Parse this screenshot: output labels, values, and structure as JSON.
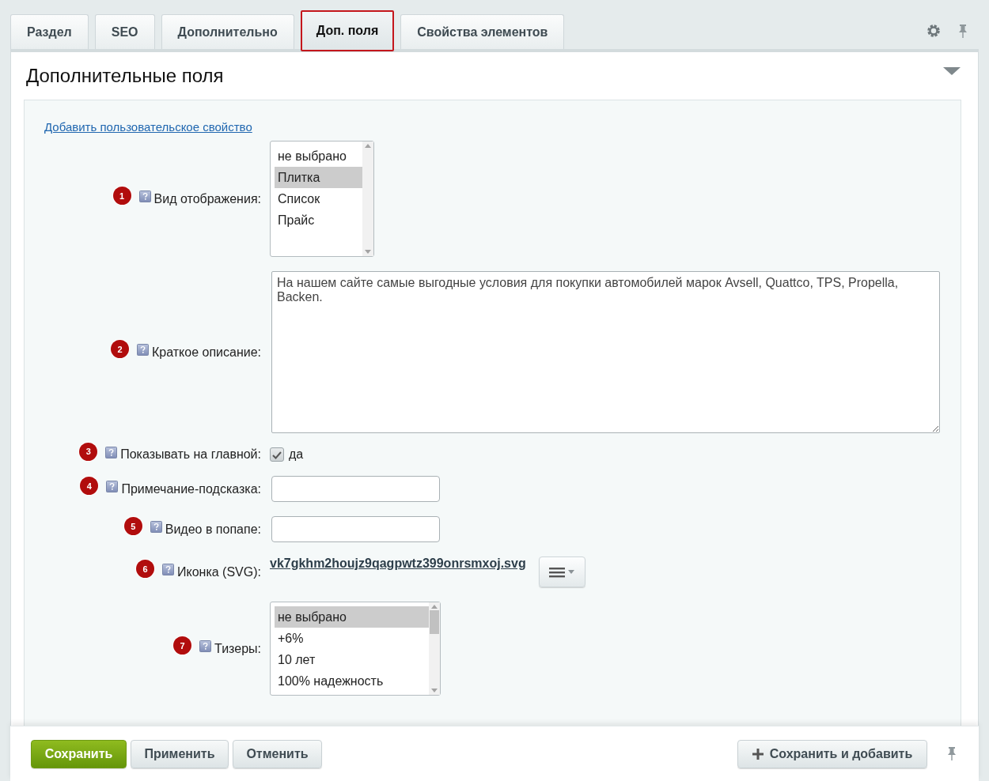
{
  "tabs": [
    {
      "label": "Раздел",
      "selected": false
    },
    {
      "label": "SEO",
      "selected": false
    },
    {
      "label": "Дополнительно",
      "selected": false
    },
    {
      "label": "Доп. поля",
      "selected": true
    },
    {
      "label": "Свойства элементов",
      "selected": false
    }
  ],
  "section": {
    "title": "Дополнительные поля",
    "expanded": true
  },
  "add_link": "Добавить пользовательское свойство",
  "fields": [
    {
      "badge": "1",
      "label": "Вид отображения:",
      "kind": "listbox",
      "scrollable": false,
      "options": [
        {
          "label": "не выбрано",
          "selected": false
        },
        {
          "label": "Плитка",
          "selected": true
        },
        {
          "label": "Список",
          "selected": false
        },
        {
          "label": "Прайс",
          "selected": false
        }
      ]
    },
    {
      "badge": "2",
      "label": "Краткое описание:",
      "kind": "textarea",
      "value": "На нашем сайте самые выгодные условия для покупки автомобилей марок Avsell, Quattco, TPS, Propella, Backen."
    },
    {
      "badge": "3",
      "label": "Показывать на главной:",
      "kind": "checkbox",
      "checked": true,
      "option": "да"
    },
    {
      "badge": "4",
      "label": "Примечание-подсказка:",
      "kind": "text"
    },
    {
      "badge": "5",
      "label": "Видео в попапе:",
      "kind": "text"
    },
    {
      "badge": "6",
      "label": "Иконка (SVG):",
      "kind": "file",
      "file": "vk7gkhm2houjz9qagpwtz399onrsmxoj.svg"
    },
    {
      "badge": "7",
      "label": "Тизеры:",
      "kind": "listbox",
      "scrollable": true,
      "options": [
        {
          "label": "не выбрано",
          "selected": true
        },
        {
          "label": "+6%",
          "selected": false
        },
        {
          "label": "10 лет",
          "selected": false
        },
        {
          "label": "100% надежность",
          "selected": false
        }
      ]
    }
  ],
  "footer": {
    "buttons": [
      {
        "label": "Сохранить",
        "kind": "primary"
      },
      {
        "label": "Применить",
        "kind": "default"
      },
      {
        "label": "Отменить",
        "kind": "default"
      }
    ],
    "save_and_add": "Сохранить и добавить"
  }
}
